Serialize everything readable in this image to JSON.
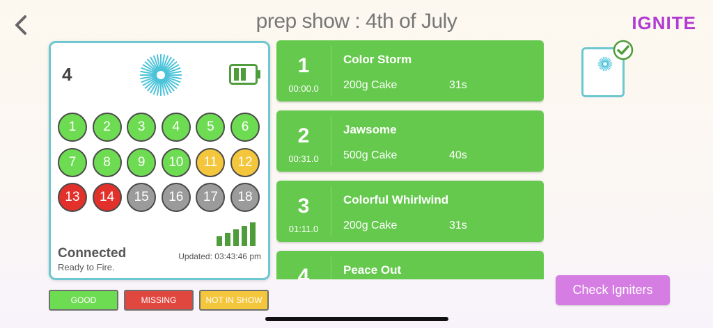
{
  "header": {
    "title": "prep show :  4th of July",
    "logo": "IGNITE"
  },
  "device": {
    "number": "4",
    "status": "Connected",
    "status_sub": "Ready to Fire.",
    "updated": "Updated: 03:43:46 pm",
    "signal_level": 5,
    "cues": [
      {
        "label": "1",
        "state": "good"
      },
      {
        "label": "2",
        "state": "good"
      },
      {
        "label": "3",
        "state": "good"
      },
      {
        "label": "4",
        "state": "good"
      },
      {
        "label": "5",
        "state": "good"
      },
      {
        "label": "6",
        "state": "good"
      },
      {
        "label": "7",
        "state": "good"
      },
      {
        "label": "8",
        "state": "good"
      },
      {
        "label": "9",
        "state": "good"
      },
      {
        "label": "10",
        "state": "good"
      },
      {
        "label": "11",
        "state": "notinshow"
      },
      {
        "label": "12",
        "state": "notinshow"
      },
      {
        "label": "13",
        "state": "missing"
      },
      {
        "label": "14",
        "state": "missing"
      },
      {
        "label": "15",
        "state": "grey"
      },
      {
        "label": "16",
        "state": "grey"
      },
      {
        "label": "17",
        "state": "grey"
      },
      {
        "label": "18",
        "state": "grey"
      }
    ]
  },
  "legend": {
    "good": "GOOD",
    "missing": "MISSING",
    "not_in_show": "NOT IN SHOW"
  },
  "cues_list": [
    {
      "number": "1",
      "time": "00:00.0",
      "name": "Color Storm",
      "product": "200g Cake",
      "duration": "31s"
    },
    {
      "number": "2",
      "time": "00:31.0",
      "name": "Jawsome",
      "product": "500g Cake",
      "duration": "40s"
    },
    {
      "number": "3",
      "time": "01:11.0",
      "name": "Colorful Whirlwind",
      "product": "200g Cake",
      "duration": "31s"
    },
    {
      "number": "4",
      "time": "",
      "name": "Peace Out",
      "product": "",
      "duration": ""
    }
  ],
  "actions": {
    "check_igniters": "Check Igniters"
  },
  "colors": {
    "good": "#6edc52",
    "not_in_show": "#f4c63c",
    "missing": "#e2312a",
    "inactive": "#9b9b9b",
    "card": "#65c94d",
    "accent": "#d57de3",
    "teal": "#6cc7d0",
    "brand": "#b23bd1"
  },
  "icons": {
    "back": "chevron-left-icon",
    "burst": "firework-burst-icon",
    "battery": "battery-icon",
    "signal": "signal-bars-icon",
    "check": "checkmark-icon"
  }
}
